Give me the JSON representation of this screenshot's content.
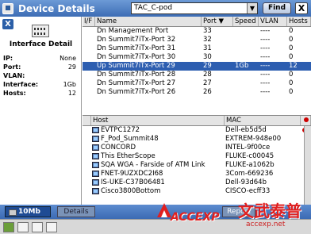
{
  "window": {
    "title": "Device Details"
  },
  "toolbar": {
    "search_value": "TAC_C-pod",
    "find_label": "Find",
    "close_label": "X"
  },
  "left": {
    "close_label": "X",
    "heading": "Interface Detail",
    "fields": [
      {
        "key": "IP:",
        "value": "None"
      },
      {
        "key": "Port:",
        "value": "29"
      },
      {
        "key": "VLAN:",
        "value": ""
      },
      {
        "key": "Interface:",
        "value": "1Gb"
      },
      {
        "key": "Hosts:",
        "value": "12"
      }
    ]
  },
  "ports": {
    "columns": [
      "I/F",
      "Name",
      "Port",
      "Speed",
      "VLAN",
      "Hosts"
    ],
    "rows": [
      {
        "if": "",
        "name": "Dn Management Port",
        "port": "33",
        "speed": "",
        "vlan": "----",
        "hosts": "0"
      },
      {
        "if": "",
        "name": "Dn Summit7iTx-Port 32",
        "port": "32",
        "speed": "",
        "vlan": "----",
        "hosts": "0"
      },
      {
        "if": "",
        "name": "Dn Summit7iTx-Port 31",
        "port": "31",
        "speed": "",
        "vlan": "----",
        "hosts": "0"
      },
      {
        "if": "",
        "name": "Dn Summit7iTx-Port 30",
        "port": "30",
        "speed": "",
        "vlan": "----",
        "hosts": "0"
      },
      {
        "if": "",
        "name": "Up Summit7iTx-Port 29",
        "port": "29",
        "speed": "1Gb",
        "vlan": "----",
        "hosts": "12",
        "selected": true
      },
      {
        "if": "",
        "name": "Dn Summit7iTx-Port 28",
        "port": "28",
        "speed": "",
        "vlan": "----",
        "hosts": "0"
      },
      {
        "if": "",
        "name": "Dn Summit7iTx-Port 27",
        "port": "27",
        "speed": "",
        "vlan": "----",
        "hosts": "0"
      },
      {
        "if": "",
        "name": "Dn Summit7iTx-Port 26",
        "port": "26",
        "speed": "",
        "vlan": "----",
        "hosts": "0"
      }
    ]
  },
  "hosts": {
    "columns": [
      "Host",
      "MAC"
    ],
    "rows": [
      {
        "name": "EVTPC1272",
        "mac": "Dell-eb5d5d",
        "flag": true
      },
      {
        "name": "F_Pod_Summit48",
        "mac": "EXTREM-948e00",
        "flag": false
      },
      {
        "name": "CONCORD",
        "mac": "INTEL-9f00ce",
        "flag": false
      },
      {
        "name": "This EtherScope",
        "mac": "FLUKE-c00045",
        "flag": false
      },
      {
        "name": "SQA WGA - Farside of ATM Link",
        "mac": "FLUKE-a1062b",
        "flag": false
      },
      {
        "name": "FNET-9UZXDC2I68",
        "mac": "3Com-669236",
        "flag": false
      },
      {
        "name": "IS-UKE-C37B06481",
        "mac": "Dell-93d64b",
        "flag": false
      },
      {
        "name": "Cisco3800Bottom",
        "mac": "CISCO-ecff33",
        "flag": false
      }
    ]
  },
  "bottom": {
    "speed_label": "10Mb",
    "details_label": "Details",
    "report_label": "Report"
  },
  "watermark": {
    "brand": "ACCEXP",
    "cn": "文武泰普",
    "url": "accexp.net"
  }
}
